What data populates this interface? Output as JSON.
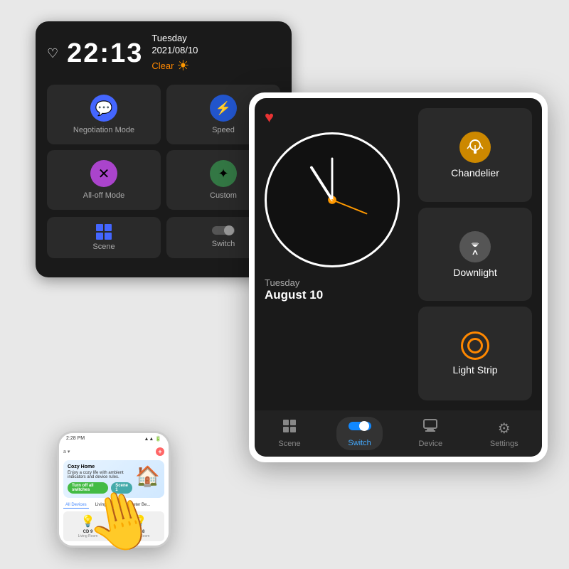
{
  "back_device": {
    "time": "22:13",
    "day": "Tuesday",
    "date": "2021/08/10",
    "weather": "Clear",
    "buttons": [
      {
        "id": "negotiation",
        "label": "Negotiation Mode",
        "icon_type": "chat"
      },
      {
        "id": "speed",
        "label": "Speed",
        "icon_type": "speed"
      },
      {
        "id": "alloff",
        "label": "All-off Mode",
        "icon_type": "close"
      },
      {
        "id": "custom",
        "label": "Custom",
        "icon_type": "custom"
      }
    ],
    "bottom": [
      {
        "id": "scene",
        "label": "Scene",
        "icon_type": "grid"
      },
      {
        "id": "switch",
        "label": "Switch",
        "icon_type": "toggle"
      }
    ]
  },
  "front_device": {
    "heart": "♥",
    "clock": {
      "day": "Tuesday",
      "date": "August 10"
    },
    "buttons": [
      {
        "id": "chandelier",
        "label": "Chandelier",
        "icon_type": "orange-lamp",
        "active": true
      },
      {
        "id": "downlight",
        "label": "Downlight",
        "icon_type": "gray-lamp",
        "active": false
      },
      {
        "id": "light-strip",
        "label": "Light Strip",
        "icon_type": "ring-lamp",
        "active": true
      }
    ],
    "nav": [
      {
        "id": "scene",
        "label": "Scene",
        "icon": "⊞",
        "active": false
      },
      {
        "id": "switch",
        "label": "Switch",
        "icon": "toggle",
        "active": true
      },
      {
        "id": "device",
        "label": "Device",
        "icon": "▦",
        "active": false
      },
      {
        "id": "settings",
        "label": "Settings",
        "icon": "⚙",
        "active": false
      }
    ]
  },
  "phone": {
    "time": "2:28 PM",
    "wifi": "▲▲▲",
    "battery": "■■■",
    "home_title": "Cozy Home",
    "home_subtitle": "Enjoy a cozy life with ambient indicators and device rules.",
    "buttons": [
      {
        "label": "Turn off all switches",
        "color": "green"
      },
      {
        "label": "Scene 1",
        "color": "teal"
      }
    ],
    "sections": [
      "All Devices",
      "Living Room",
      "Master Be..."
    ],
    "devices": [
      {
        "name": "CD 9",
        "room": "Living Room",
        "icon": "💡"
      },
      {
        "name": "CD 8",
        "room": "Living Room",
        "icon": "💡"
      }
    ]
  }
}
